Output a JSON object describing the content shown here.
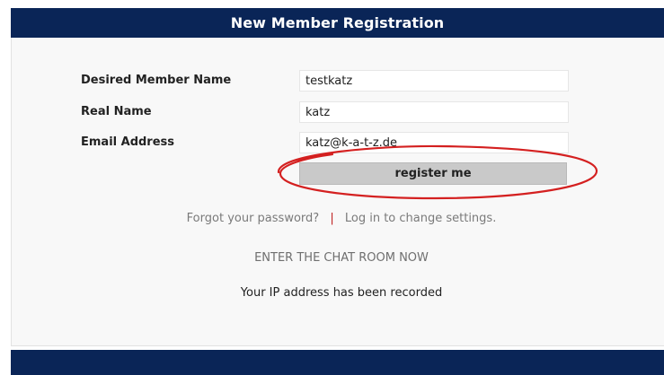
{
  "header": {
    "title": "New Member Registration"
  },
  "form": {
    "member_name_label": "Desired Member Name",
    "member_name_value": "testkatz",
    "real_name_label": "Real Name",
    "real_name_value": "katz",
    "email_label": "Email Address",
    "email_value": "katz@k-a-t-z.de",
    "register_label": "register me"
  },
  "links": {
    "forgot_password": "Forgot your password?",
    "separator": "|",
    "login_change": "Log in to change settings.",
    "enter_chat": "ENTER THE CHAT ROOM NOW"
  },
  "notice": {
    "ip_recorded": "Your IP address has been recorded"
  },
  "colors": {
    "header_bg": "#0a2557",
    "annotation": "#d42020"
  }
}
